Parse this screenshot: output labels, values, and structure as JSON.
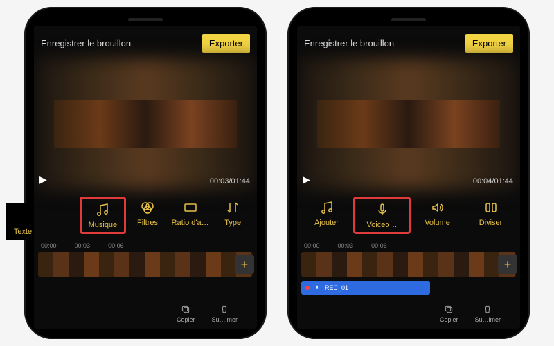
{
  "shared": {
    "draft_label": "Enregistrer le brouillon",
    "export_label": "Exporter",
    "ruler": [
      "00:00",
      "00:03",
      "00:06"
    ],
    "add_clip": "+",
    "bottom": {
      "copy": "Copier",
      "delete": "Su…imer"
    }
  },
  "left": {
    "timecode": "00:03/01:44",
    "tools": [
      {
        "key": "texte",
        "label": "Texte"
      },
      {
        "key": "musique",
        "label": "Musique",
        "highlighted": true
      },
      {
        "key": "filtres",
        "label": "Filtres"
      },
      {
        "key": "ratio",
        "label": "Ratio d'a…"
      },
      {
        "key": "type",
        "label": "Type"
      }
    ]
  },
  "right": {
    "timecode": "00:04/01:44",
    "tools": [
      {
        "key": "ajouter",
        "label": "Ajouter"
      },
      {
        "key": "voiceover",
        "label": "Voiceo…",
        "highlighted": true
      },
      {
        "key": "volume",
        "label": "Volume"
      },
      {
        "key": "diviser",
        "label": "Diviser"
      }
    ],
    "audio_clip": "REC_01"
  }
}
